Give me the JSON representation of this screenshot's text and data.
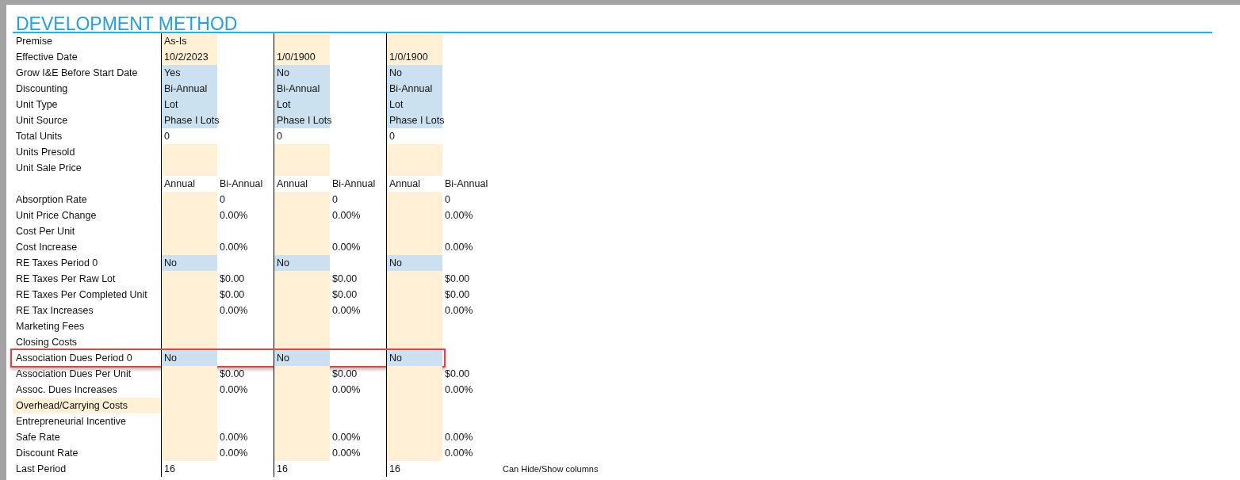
{
  "title": "DEVELOPMENT METHOD",
  "rows": [
    {
      "label": "Premise",
      "label_shaded": false,
      "highlighted": false,
      "cells": [
        {
          "text": "As-Is",
          "kind": "input"
        },
        {
          "kind": "plain"
        },
        {
          "kind": "input"
        },
        {
          "kind": "plain"
        },
        {
          "kind": "input"
        },
        {
          "kind": "plain"
        }
      ]
    },
    {
      "label": "Effective Date",
      "label_shaded": false,
      "highlighted": false,
      "cells": [
        {
          "text": "10/2/2023",
          "kind": "input"
        },
        {
          "kind": "plain"
        },
        {
          "text": "1/0/1900",
          "kind": "input"
        },
        {
          "kind": "plain"
        },
        {
          "text": "1/0/1900",
          "kind": "input"
        },
        {
          "kind": "plain"
        }
      ]
    },
    {
      "label": "Grow I&E Before Start Date",
      "label_shaded": false,
      "highlighted": false,
      "cells": [
        {
          "text": "Yes",
          "kind": "choice"
        },
        {
          "kind": "plain"
        },
        {
          "text": "No",
          "kind": "choice"
        },
        {
          "kind": "plain"
        },
        {
          "text": "No",
          "kind": "choice"
        },
        {
          "kind": "plain"
        }
      ]
    },
    {
      "label": "Discounting",
      "label_shaded": false,
      "highlighted": false,
      "cells": [
        {
          "text": "Bi-Annual",
          "kind": "choice"
        },
        {
          "kind": "plain"
        },
        {
          "text": "Bi-Annual",
          "kind": "choice"
        },
        {
          "kind": "plain"
        },
        {
          "text": "Bi-Annual",
          "kind": "choice"
        },
        {
          "kind": "plain"
        }
      ]
    },
    {
      "label": "Unit Type",
      "label_shaded": false,
      "highlighted": false,
      "cells": [
        {
          "text": "Lot",
          "kind": "choice"
        },
        {
          "kind": "plain"
        },
        {
          "text": "Lot",
          "kind": "choice"
        },
        {
          "kind": "plain"
        },
        {
          "text": "Lot",
          "kind": "choice"
        },
        {
          "kind": "plain"
        }
      ]
    },
    {
      "label": "Unit Source",
      "label_shaded": false,
      "highlighted": false,
      "cells": [
        {
          "text": "Phase I Lots",
          "kind": "choice"
        },
        {
          "kind": "plain"
        },
        {
          "text": "Phase I Lots",
          "kind": "choice"
        },
        {
          "kind": "plain"
        },
        {
          "text": "Phase I Lots",
          "kind": "choice"
        },
        {
          "kind": "plain"
        }
      ]
    },
    {
      "label": "Total Units",
      "label_shaded": false,
      "highlighted": false,
      "cells": [
        {
          "text": "0",
          "kind": "plain"
        },
        {
          "kind": "plain"
        },
        {
          "text": "0",
          "kind": "plain"
        },
        {
          "kind": "plain"
        },
        {
          "text": "0",
          "kind": "plain"
        },
        {
          "kind": "plain"
        }
      ]
    },
    {
      "label": "Units Presold",
      "label_shaded": false,
      "highlighted": false,
      "cells": [
        {
          "kind": "input"
        },
        {
          "kind": "plain"
        },
        {
          "kind": "input"
        },
        {
          "kind": "plain"
        },
        {
          "kind": "input"
        },
        {
          "kind": "plain"
        }
      ]
    },
    {
      "label": "Unit Sale Price",
      "label_shaded": false,
      "highlighted": false,
      "cells": [
        {
          "kind": "input"
        },
        {
          "kind": "plain"
        },
        {
          "kind": "input"
        },
        {
          "kind": "plain"
        },
        {
          "kind": "input"
        },
        {
          "kind": "plain"
        }
      ]
    },
    {
      "label_shaded": false,
      "highlighted": false,
      "cells": [
        {
          "text": "Annual",
          "kind": "plain"
        },
        {
          "text": "Bi-Annual",
          "kind": "plain"
        },
        {
          "text": "Annual",
          "kind": "plain"
        },
        {
          "text": "Bi-Annual",
          "kind": "plain"
        },
        {
          "text": "Annual",
          "kind": "plain"
        },
        {
          "text": "Bi-Annual",
          "kind": "plain"
        }
      ]
    },
    {
      "label": "Absorption Rate",
      "label_shaded": false,
      "highlighted": false,
      "cells": [
        {
          "kind": "input"
        },
        {
          "text": "0",
          "kind": "plain"
        },
        {
          "kind": "input"
        },
        {
          "text": "0",
          "kind": "plain"
        },
        {
          "kind": "input"
        },
        {
          "text": "0",
          "kind": "plain"
        }
      ]
    },
    {
      "label": "Unit Price Change",
      "label_shaded": false,
      "highlighted": false,
      "cells": [
        {
          "kind": "input"
        },
        {
          "text": "0.00%",
          "kind": "plain"
        },
        {
          "kind": "input"
        },
        {
          "text": "0.00%",
          "kind": "plain"
        },
        {
          "kind": "input"
        },
        {
          "text": "0.00%",
          "kind": "plain"
        }
      ]
    },
    {
      "label": "Cost Per Unit",
      "label_shaded": false,
      "highlighted": false,
      "cells": [
        {
          "kind": "input"
        },
        {
          "kind": "plain"
        },
        {
          "kind": "input"
        },
        {
          "kind": "plain"
        },
        {
          "kind": "input"
        },
        {
          "kind": "plain"
        }
      ]
    },
    {
      "label": "Cost Increase",
      "label_shaded": false,
      "highlighted": false,
      "cells": [
        {
          "kind": "input"
        },
        {
          "text": "0.00%",
          "kind": "plain"
        },
        {
          "kind": "input"
        },
        {
          "text": "0.00%",
          "kind": "plain"
        },
        {
          "kind": "input"
        },
        {
          "text": "0.00%",
          "kind": "plain"
        }
      ]
    },
    {
      "label": "RE Taxes Period 0",
      "label_shaded": false,
      "highlighted": false,
      "cells": [
        {
          "text": "No",
          "kind": "choice"
        },
        {
          "kind": "plain"
        },
        {
          "text": "No",
          "kind": "choice"
        },
        {
          "kind": "plain"
        },
        {
          "text": "No",
          "kind": "choice"
        },
        {
          "kind": "plain"
        }
      ]
    },
    {
      "label": "RE Taxes Per Raw Lot",
      "label_shaded": false,
      "highlighted": false,
      "cells": [
        {
          "kind": "input"
        },
        {
          "text": "$0.00",
          "kind": "plain"
        },
        {
          "kind": "input"
        },
        {
          "text": "$0.00",
          "kind": "plain"
        },
        {
          "kind": "input"
        },
        {
          "text": "$0.00",
          "kind": "plain"
        }
      ]
    },
    {
      "label": "RE Taxes Per Completed Unit",
      "label_shaded": false,
      "highlighted": false,
      "cells": [
        {
          "kind": "input"
        },
        {
          "text": "$0.00",
          "kind": "plain"
        },
        {
          "kind": "input"
        },
        {
          "text": "$0.00",
          "kind": "plain"
        },
        {
          "kind": "input"
        },
        {
          "text": "$0.00",
          "kind": "plain"
        }
      ]
    },
    {
      "label": "RE Tax Increases",
      "label_shaded": false,
      "highlighted": false,
      "cells": [
        {
          "kind": "input"
        },
        {
          "text": "0.00%",
          "kind": "plain"
        },
        {
          "kind": "input"
        },
        {
          "text": "0.00%",
          "kind": "plain"
        },
        {
          "kind": "input"
        },
        {
          "text": "0.00%",
          "kind": "plain"
        }
      ]
    },
    {
      "label": "Marketing Fees",
      "label_shaded": false,
      "highlighted": false,
      "cells": [
        {
          "kind": "input"
        },
        {
          "kind": "plain"
        },
        {
          "kind": "input"
        },
        {
          "kind": "plain"
        },
        {
          "kind": "input"
        },
        {
          "kind": "plain"
        }
      ]
    },
    {
      "label": "Closing Costs",
      "label_shaded": false,
      "highlighted": false,
      "cells": [
        {
          "kind": "input"
        },
        {
          "kind": "plain"
        },
        {
          "kind": "input"
        },
        {
          "kind": "plain"
        },
        {
          "kind": "input"
        },
        {
          "kind": "plain"
        }
      ]
    },
    {
      "label": "Association Dues Period 0",
      "label_shaded": false,
      "highlighted": true,
      "cells": [
        {
          "text": "No",
          "kind": "choice"
        },
        {
          "kind": "plain"
        },
        {
          "text": "No",
          "kind": "choice"
        },
        {
          "kind": "plain"
        },
        {
          "text": "No",
          "kind": "choice"
        },
        {
          "kind": "plain"
        }
      ]
    },
    {
      "label": "Association Dues Per Unit",
      "label_shaded": false,
      "highlighted": false,
      "cells": [
        {
          "kind": "input"
        },
        {
          "text": "$0.00",
          "kind": "plain"
        },
        {
          "kind": "input"
        },
        {
          "text": "$0.00",
          "kind": "plain"
        },
        {
          "kind": "input"
        },
        {
          "text": "$0.00",
          "kind": "plain"
        }
      ]
    },
    {
      "label": "Assoc. Dues Increases",
      "label_shaded": false,
      "highlighted": false,
      "cells": [
        {
          "kind": "input"
        },
        {
          "text": "0.00%",
          "kind": "plain"
        },
        {
          "kind": "input"
        },
        {
          "text": "0.00%",
          "kind": "plain"
        },
        {
          "kind": "input"
        },
        {
          "text": "0.00%",
          "kind": "plain"
        }
      ]
    },
    {
      "label": "Overhead/Carrying Costs",
      "label_shaded": true,
      "highlighted": false,
      "cells": [
        {
          "kind": "input"
        },
        {
          "kind": "plain"
        },
        {
          "kind": "input"
        },
        {
          "kind": "plain"
        },
        {
          "kind": "input"
        },
        {
          "kind": "plain"
        }
      ]
    },
    {
      "label": "Entrepreneurial Incentive",
      "label_shaded": false,
      "highlighted": false,
      "cells": [
        {
          "kind": "input"
        },
        {
          "kind": "plain"
        },
        {
          "kind": "input"
        },
        {
          "kind": "plain"
        },
        {
          "kind": "input"
        },
        {
          "kind": "plain"
        }
      ]
    },
    {
      "label": "Safe Rate",
      "label_shaded": false,
      "highlighted": false,
      "cells": [
        {
          "kind": "input"
        },
        {
          "text": "0.00%",
          "kind": "plain"
        },
        {
          "kind": "input"
        },
        {
          "text": "0.00%",
          "kind": "plain"
        },
        {
          "kind": "input"
        },
        {
          "text": "0.00%",
          "kind": "plain"
        }
      ]
    },
    {
      "label": "Discount Rate",
      "label_shaded": false,
      "highlighted": false,
      "cells": [
        {
          "kind": "input"
        },
        {
          "text": "0.00%",
          "kind": "plain"
        },
        {
          "kind": "input"
        },
        {
          "text": "0.00%",
          "kind": "plain"
        },
        {
          "kind": "input"
        },
        {
          "text": "0.00%",
          "kind": "plain"
        }
      ]
    },
    {
      "label": "Last Period",
      "label_shaded": false,
      "highlighted": false,
      "note": "Can Hide/Show columns",
      "cells": [
        {
          "text": "16",
          "kind": "plain"
        },
        {
          "kind": "plain"
        },
        {
          "text": "16",
          "kind": "plain"
        },
        {
          "kind": "plain"
        },
        {
          "text": "16",
          "kind": "plain"
        },
        {
          "kind": "plain"
        }
      ]
    }
  ]
}
